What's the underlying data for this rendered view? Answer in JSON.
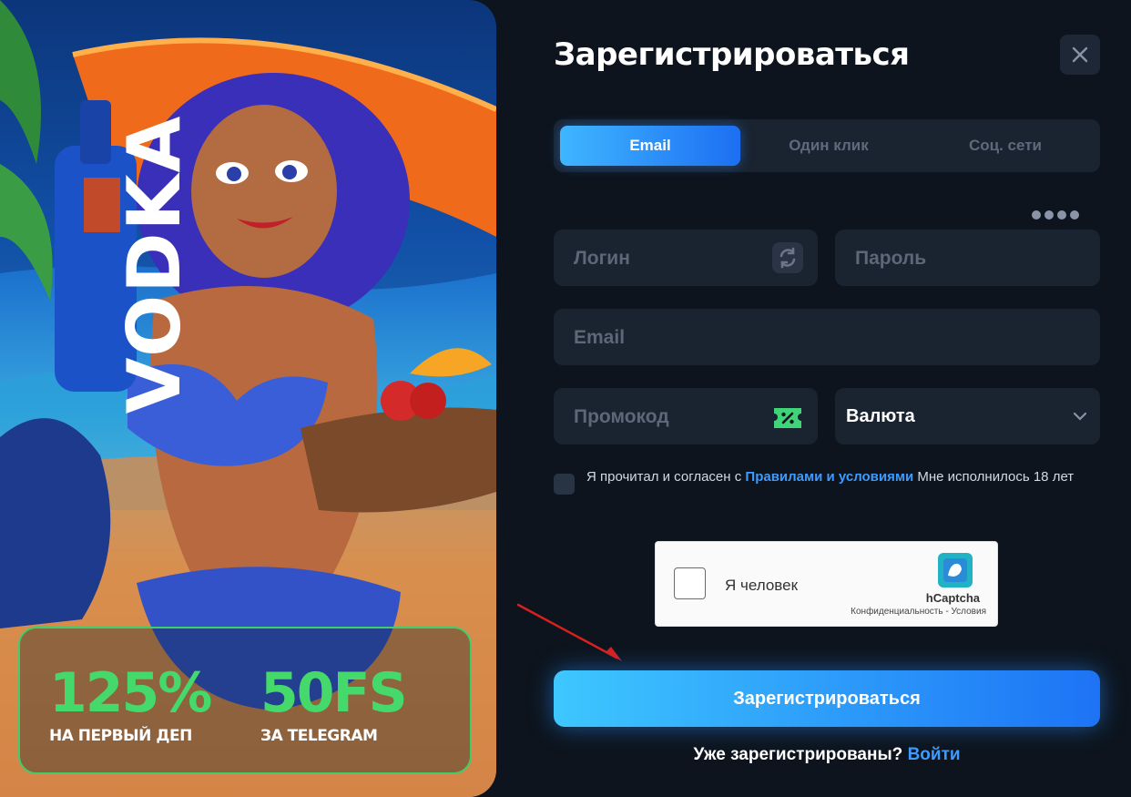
{
  "promo": {
    "brand": "VODKA",
    "bonuses": [
      {
        "value": "125%",
        "caption": "НА ПЕРВЫЙ ДЕП"
      },
      {
        "value": "50FS",
        "caption": "ЗА TELEGRAM"
      }
    ],
    "accent_color": "#44d96a"
  },
  "form": {
    "title": "Зарегистрироваться",
    "close_icon": "close-icon",
    "tabs": [
      {
        "label": "Email",
        "active": true
      },
      {
        "label": "Один клик",
        "active": false
      },
      {
        "label": "Соц. сети",
        "active": false
      }
    ],
    "fields": {
      "login_placeholder": "Логин",
      "password_placeholder": "Пароль",
      "email_placeholder": "Email",
      "promo_placeholder": "Промокод",
      "currency_label": "Валюта"
    },
    "agree": {
      "prefix": "Я прочитал и согласен с",
      "link": "Правилами и условиями",
      "suffix": "Мне исполнилось 18 лет"
    },
    "captcha": {
      "label": "Я человек",
      "brand": "hCaptcha",
      "privacy": "Конфиденциальность",
      "separator": " - ",
      "terms": "Условия"
    },
    "submit_label": "Зарегистрироваться",
    "already_text": "Уже зарегистрированы?",
    "login_link": "Войти"
  },
  "colors": {
    "background": "#0d141d",
    "field": "#1a2330",
    "primary": "#1d73f5",
    "link": "#3d9bff"
  }
}
